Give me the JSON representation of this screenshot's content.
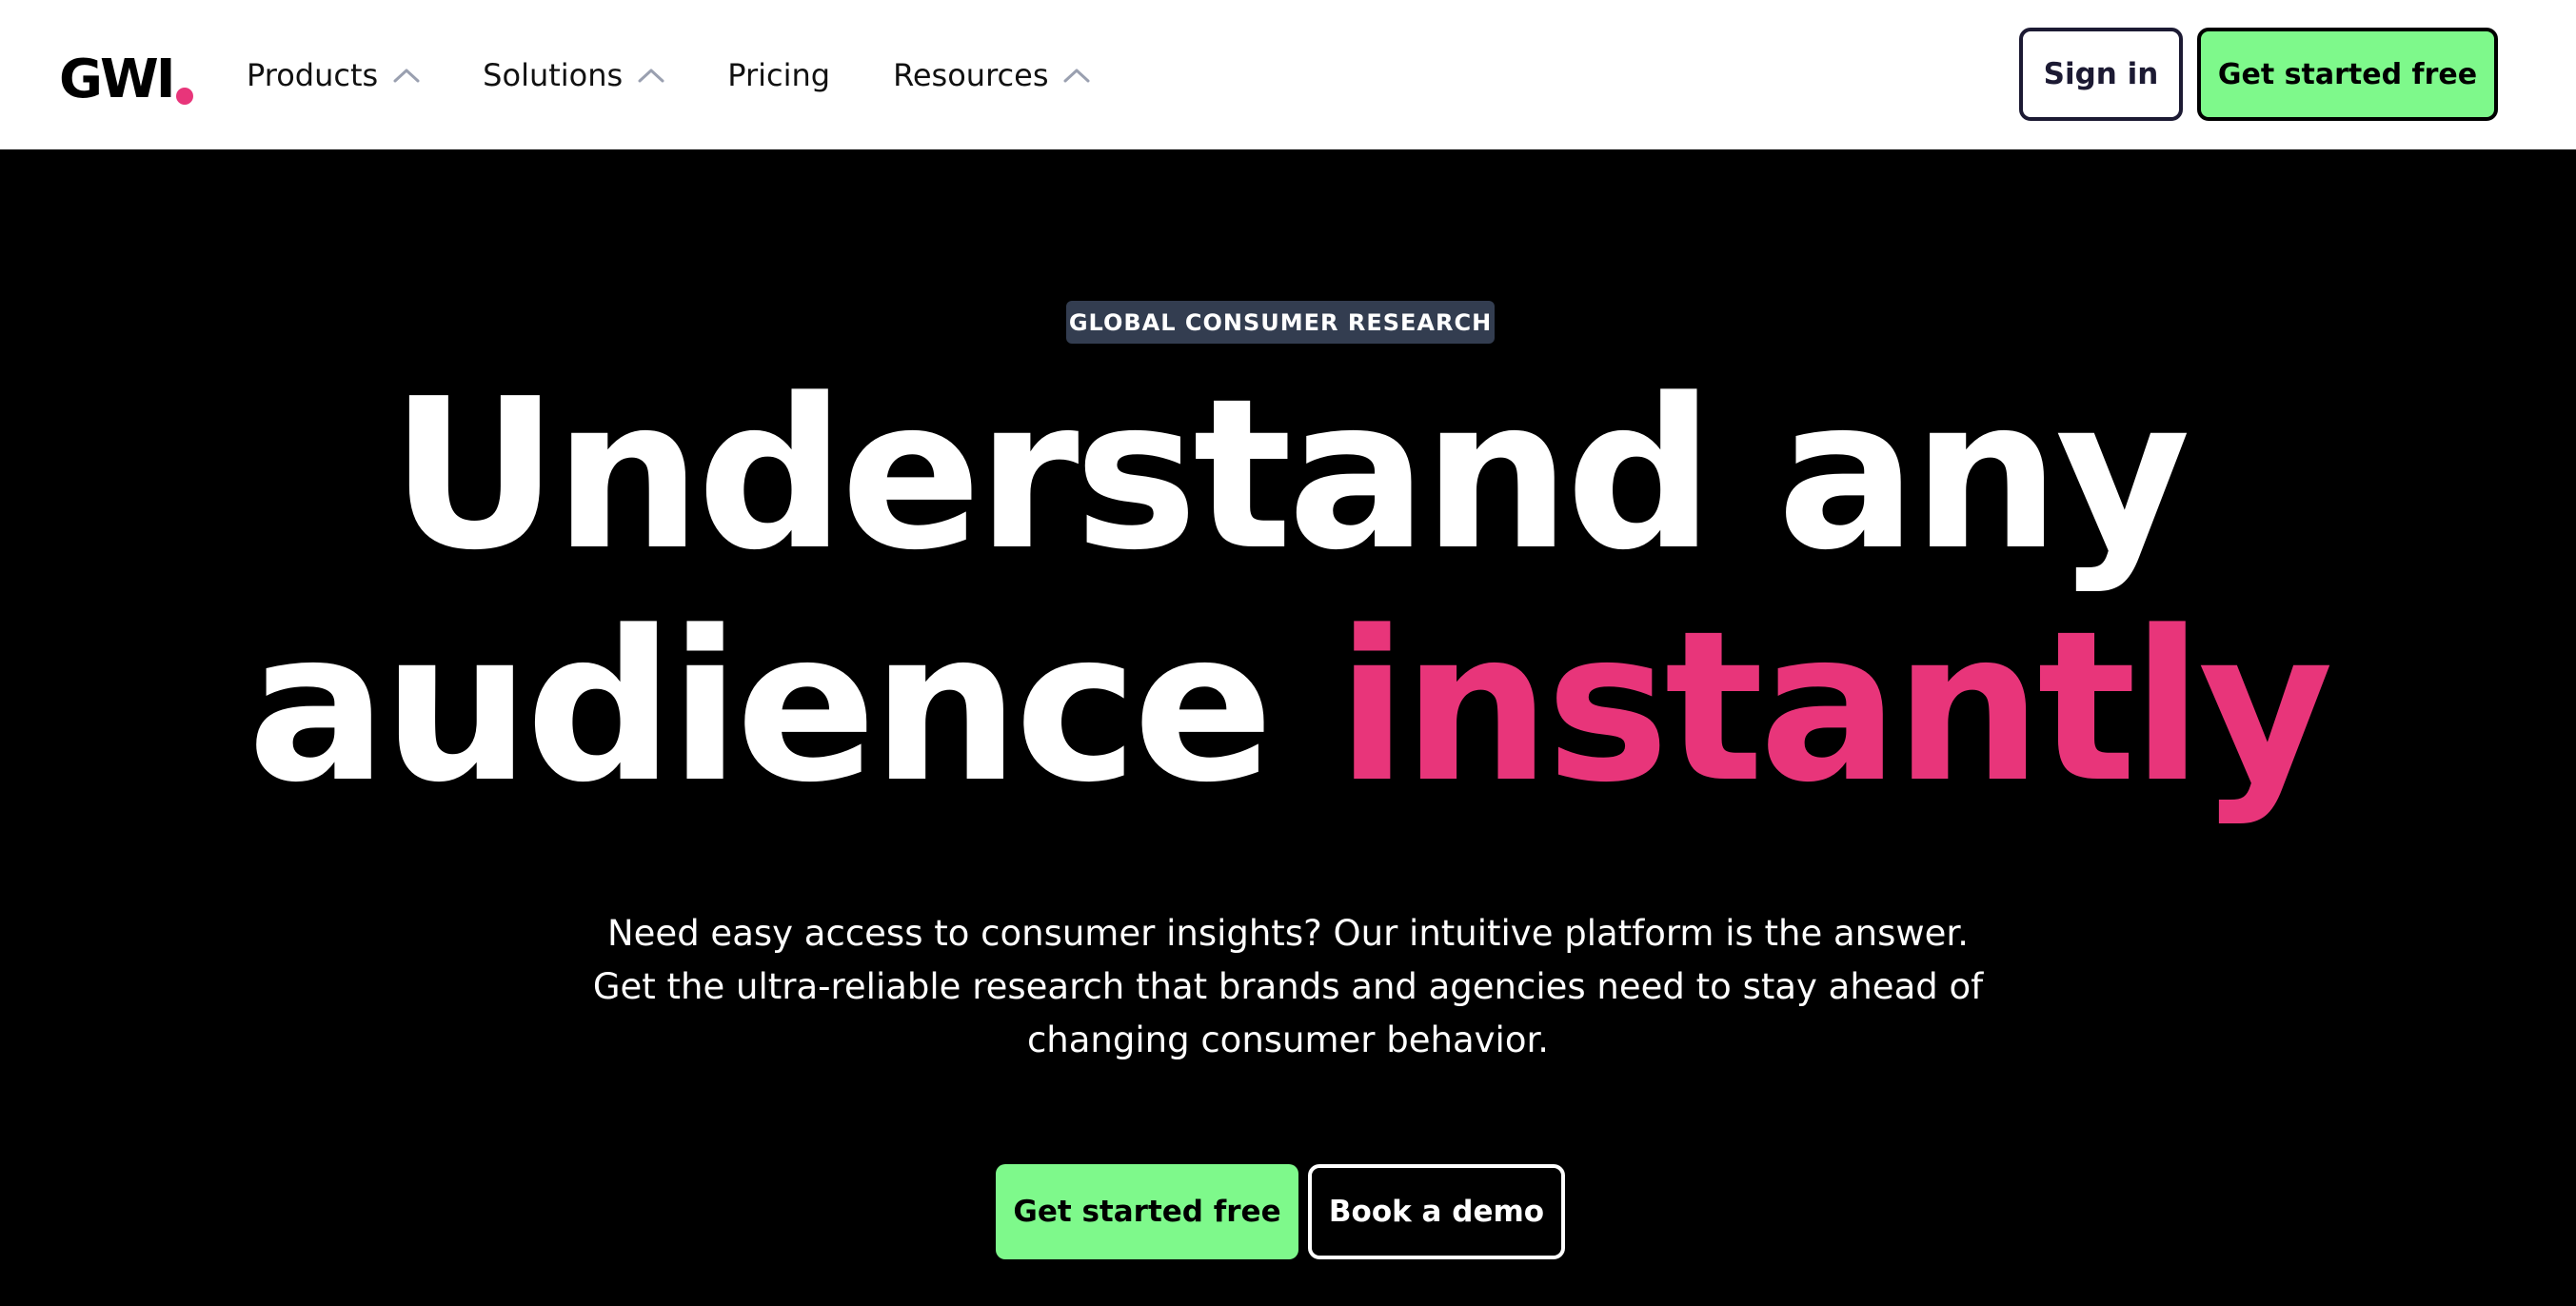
{
  "header": {
    "logo": "GWI",
    "nav": [
      {
        "label": "Products",
        "has_dropdown": true
      },
      {
        "label": "Solutions",
        "has_dropdown": true
      },
      {
        "label": "Pricing",
        "has_dropdown": false
      },
      {
        "label": "Resources",
        "has_dropdown": true
      }
    ],
    "sign_in_label": "Sign in",
    "cta_label": "Get started free"
  },
  "hero": {
    "eyebrow": "GLOBAL CONSUMER RESEARCH",
    "headline_line1": "Understand any",
    "headline_line2_plain": "audience ",
    "headline_line2_accent": "instantly",
    "subtext_lines": [
      "Need easy access to consumer insights? Our intuitive platform is the answer.",
      "Get the ultra-reliable research that brands and agencies need to stay ahead of",
      "changing consumer behavior."
    ],
    "primary_cta": "Get started free",
    "secondary_cta": "Book a demo"
  },
  "icons": {
    "nav_caret": "chevron-up-icon"
  },
  "colors": {
    "brand_pink": "#e8357a",
    "cta_green": "#7ef98b",
    "hero_background": "#000000",
    "eyebrow_background": "#333d50",
    "header_background": "#ffffff",
    "sign_in_border": "#1c1a33"
  }
}
